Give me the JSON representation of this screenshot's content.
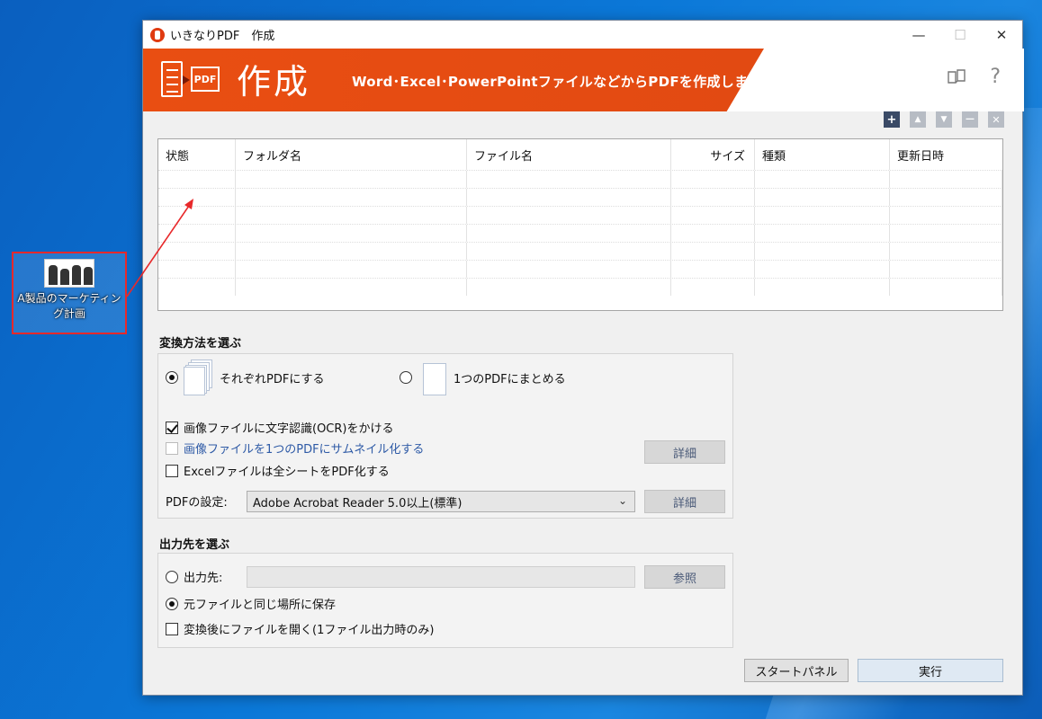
{
  "desktop": {
    "file_icon": {
      "label_line1": "A製品のマーケティン",
      "label_line2": "グ計画"
    }
  },
  "window": {
    "title": "いきなりPDF　作成",
    "controls": {
      "minimize": "—",
      "maximize": "☐",
      "close": "✕"
    }
  },
  "banner": {
    "icon_text": "PDF",
    "title": "作成",
    "subtitle": "Word･Excel･PowerPointファイルなどからPDFを作成します",
    "help_book_icon": "book-icon",
    "help_q": "?"
  },
  "list_toolbar": {
    "add": "+",
    "up": "▲",
    "down": "▼",
    "remove": "—",
    "clear": "✕"
  },
  "file_table": {
    "columns": [
      "状態",
      "フォルダ名",
      "ファイル名",
      "サイズ",
      "種類",
      "更新日時"
    ],
    "rows": []
  },
  "conversion": {
    "section_label": "変換方法を選ぶ",
    "option_each": "それぞれPDFにする",
    "option_merge": "1つのPDFにまとめる",
    "ocr": "画像ファイルに文字認識(OCR)をかける",
    "thumbnail": "画像ファイルを1つのPDFにサムネイル化する",
    "excel_all_sheets": "Excelファイルは全シートをPDF化する",
    "detail_button_1": "詳細",
    "pdf_setting_label": "PDFの設定:",
    "pdf_setting_value": "Adobe Acrobat Reader 5.0以上(標準)",
    "detail_button_2": "詳細"
  },
  "output": {
    "section_label": "出力先を選ぶ",
    "option_dest": "出力先:",
    "browse_button": "参照",
    "option_same_place": "元ファイルと同じ場所に保存",
    "open_after": "変換後にファイルを開く(1ファイル出力時のみ)"
  },
  "actions": {
    "start_panel": "スタートパネル",
    "run": "実行"
  },
  "colors": {
    "banner_accent": "#e94e12",
    "annotation_red": "#e8292b"
  }
}
